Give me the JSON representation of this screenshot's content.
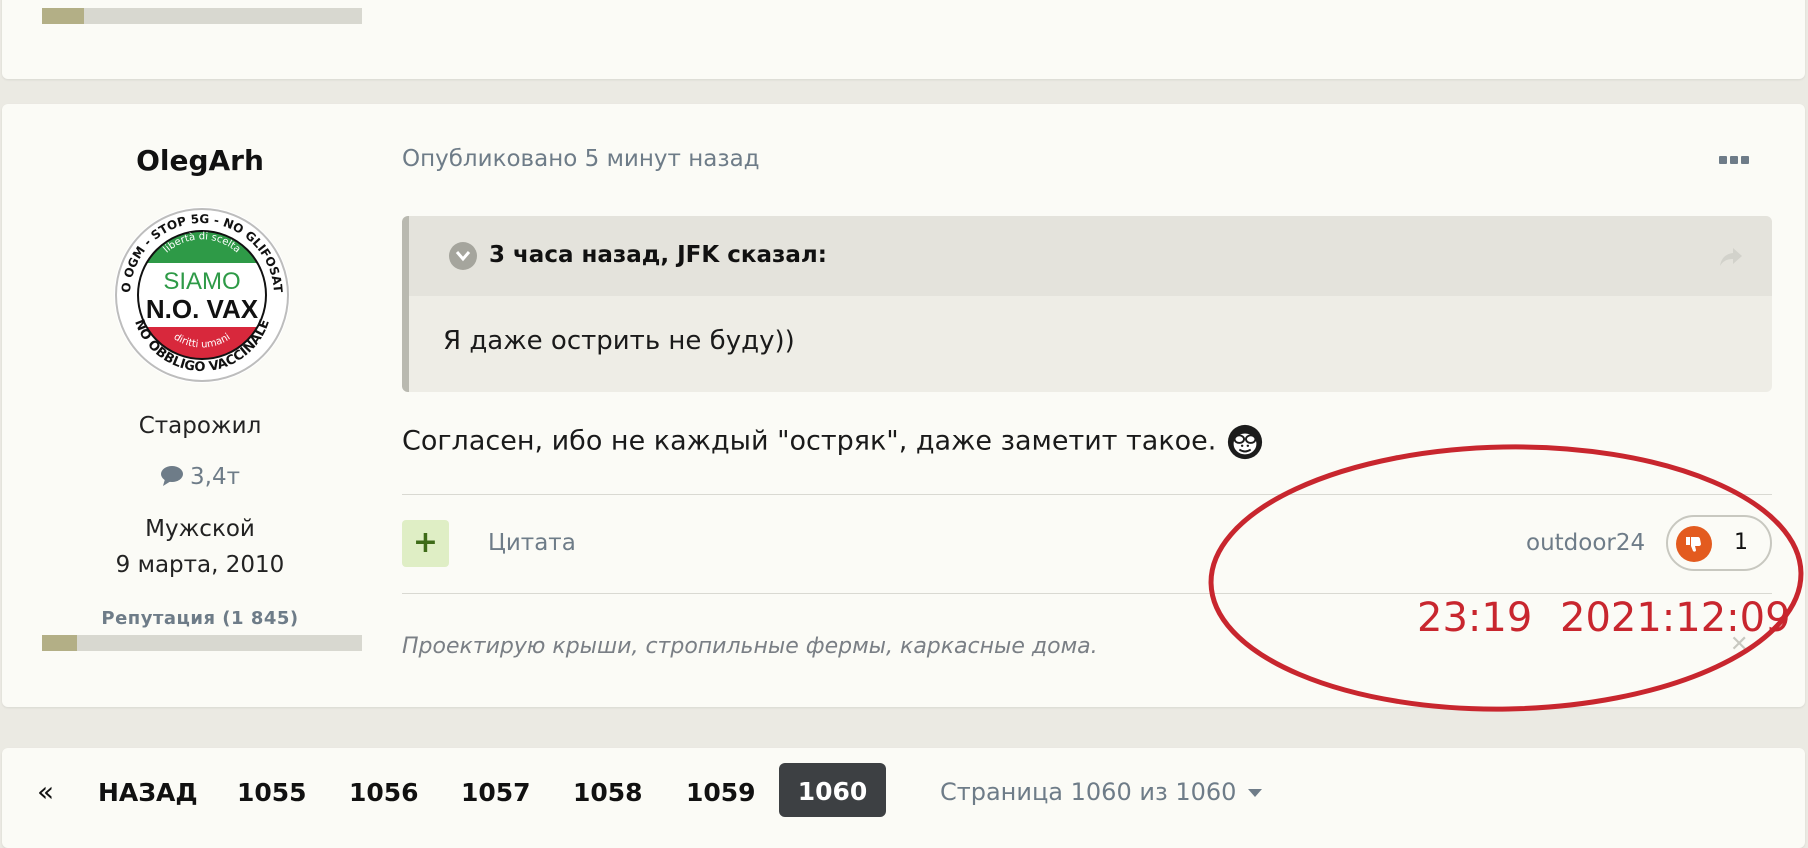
{
  "previous_post": {
    "reputation_fraction": 0.13
  },
  "post": {
    "author": {
      "name": "OlegArh",
      "avatar": {
        "name": "siamo-no-vax-badge",
        "lines": [
          "SIAMO",
          "N.O. VAX"
        ],
        "ring_text_top": "NO OGM - STOP 5G - NO GLIFOSATO",
        "ring_text_bottom": "NO OBBLIGO VACCINALE",
        "inner_top": "libertà di scelta",
        "inner_bottom": "diritti umani",
        "colors": {
          "green": "#2e9a47",
          "red": "#d8283c"
        }
      },
      "rank": "Старожил",
      "posts_count": "3,4т",
      "gender": "Мужской",
      "joined": "9 марта, 2010",
      "reputation_label": "Репутация (1 845)",
      "reputation_fraction": 0.11
    },
    "published": "Опубликовано 5 минут назад",
    "quote": {
      "header": "3 часа назад, JFK сказал:",
      "text": "Я даже острить не буду))"
    },
    "body": "Согласен, ибо не каждый \"остряк\", даже заметит такое.",
    "emoji_icon": "see-no-evil-monkey",
    "actions": {
      "quote_label": "Цитата",
      "reactor": "outdoor24",
      "reaction_icon": "thumbs-down-icon",
      "reaction_count": "1"
    },
    "signature": "Проектирую крыши, стропильные фермы, каркасные дома.",
    "annotation": {
      "time": "23:19",
      "date": "2021:12:09",
      "color": "#c8262e"
    }
  },
  "pagination": {
    "first_icon": "«",
    "prev_label": "НАЗАД",
    "pages": [
      "1055",
      "1056",
      "1057",
      "1058",
      "1059"
    ],
    "current": "1060",
    "jump_label": "Страница 1060 из 1060"
  },
  "colors": {
    "page_bg": "#ebeae3",
    "card_bg": "#fbfbf6",
    "muted_text": "#6e7c88",
    "reaction": "#e35b1f",
    "plus_bg": "#dfeec5"
  }
}
